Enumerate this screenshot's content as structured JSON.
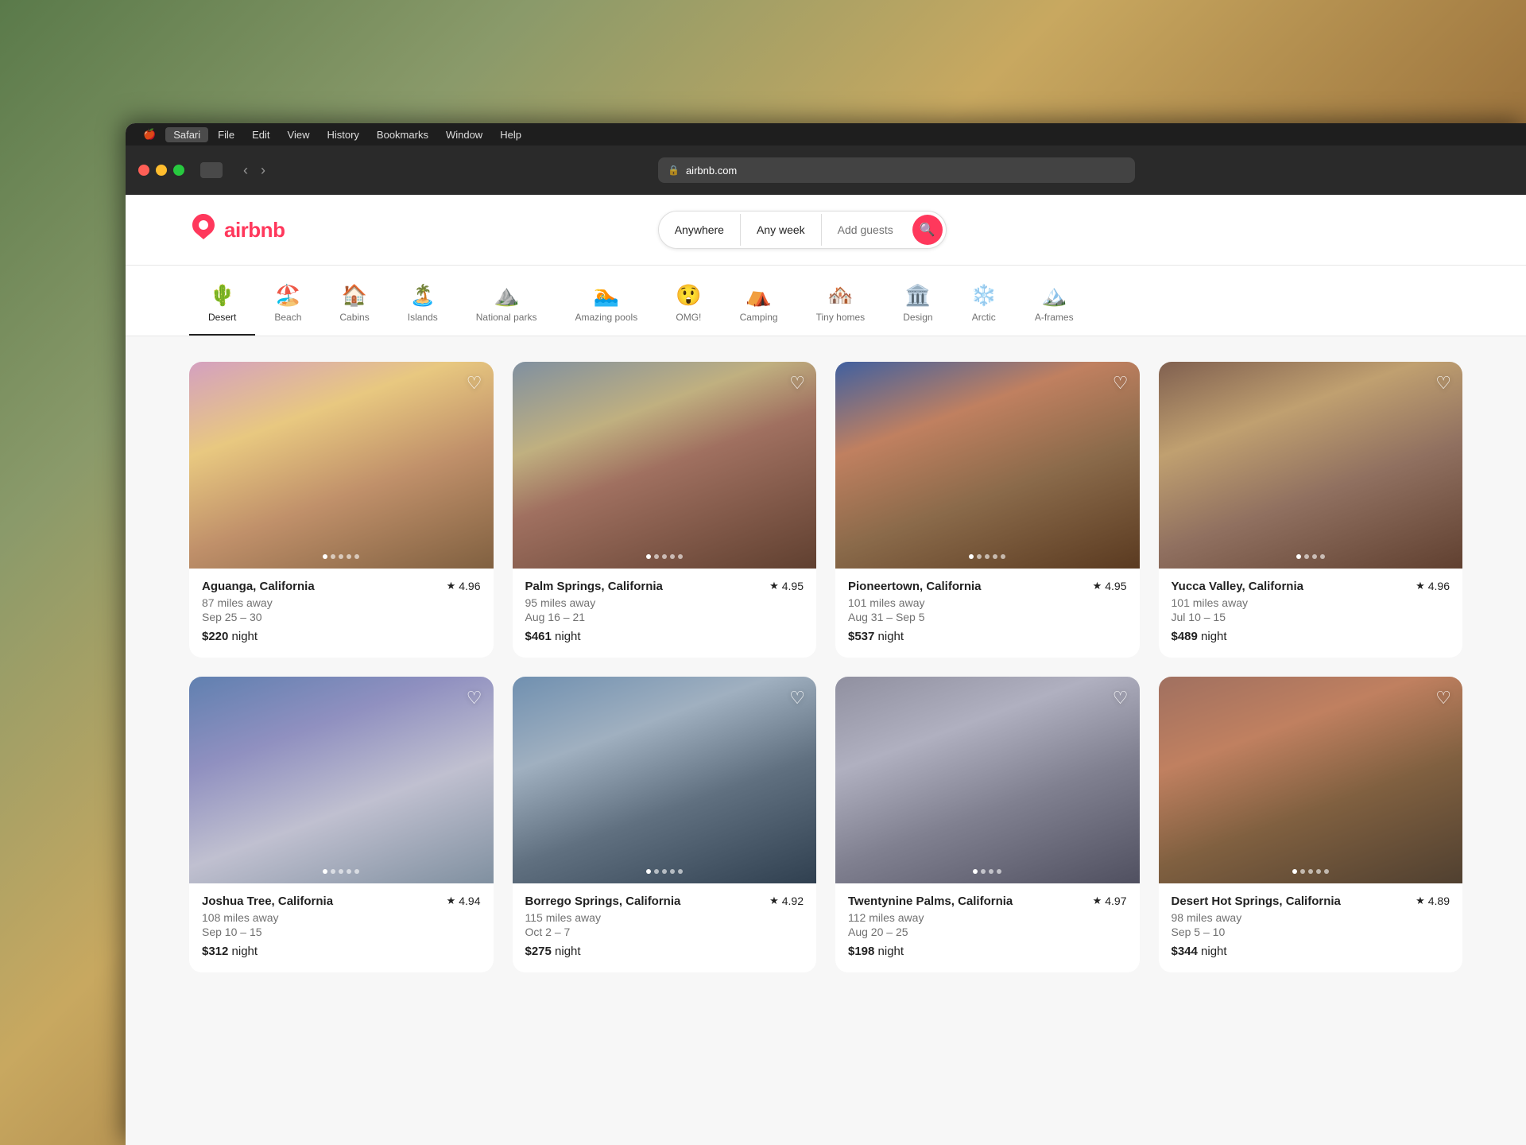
{
  "background": {
    "description": "wooden table background with plants"
  },
  "browser": {
    "menubar": {
      "apple": "🍎",
      "items": [
        "Safari",
        "File",
        "Edit",
        "View",
        "History",
        "Bookmarks",
        "Window",
        "Help"
      ]
    },
    "addressbar": {
      "url": "airbnb.com",
      "lock": "🔒"
    },
    "controls": {
      "back": "‹",
      "forward": "›"
    }
  },
  "header": {
    "logo_text": "airbnb",
    "search": {
      "anywhere": "Anywhere",
      "any_week": "Any week",
      "add_guests": "Add guests",
      "search_icon": "🔍"
    }
  },
  "categories": [
    {
      "id": "desert",
      "label": "Desert",
      "icon": "🌵",
      "active": true
    },
    {
      "id": "beach",
      "label": "Beach",
      "icon": "🏖️",
      "active": false
    },
    {
      "id": "cabins",
      "label": "Cabins",
      "icon": "🏠",
      "active": false
    },
    {
      "id": "islands",
      "label": "Islands",
      "icon": "🏝️",
      "active": false
    },
    {
      "id": "national-parks",
      "label": "National parks",
      "icon": "⛰️",
      "active": false
    },
    {
      "id": "amazing-pools",
      "label": "Amazing pools",
      "icon": "🏊",
      "active": false
    },
    {
      "id": "omg",
      "label": "OMG!",
      "icon": "😲",
      "active": false
    },
    {
      "id": "camping",
      "label": "Camping",
      "icon": "⛺",
      "active": false
    },
    {
      "id": "tiny-homes",
      "label": "Tiny homes",
      "icon": "🏘️",
      "active": false
    },
    {
      "id": "design",
      "label": "Design",
      "icon": "🏛️",
      "active": false
    },
    {
      "id": "arctic",
      "label": "Arctic",
      "icon": "❄️",
      "active": false
    },
    {
      "id": "a-frames",
      "label": "A-frames",
      "icon": "🏔️",
      "active": false
    }
  ],
  "listings": {
    "row1": [
      {
        "id": "aguanga",
        "location": "Aguanga, California",
        "rating": "4.96",
        "distance": "87 miles away",
        "dates": "Sep 25 – 30",
        "price": "$220",
        "price_unit": "night",
        "img_class": "img-aguanga",
        "dots": 5
      },
      {
        "id": "palm-springs",
        "location": "Palm Springs, California",
        "rating": "4.95",
        "distance": "95 miles away",
        "dates": "Aug 16 – 21",
        "price": "$461",
        "price_unit": "night",
        "img_class": "img-palmsprings",
        "dots": 5
      },
      {
        "id": "pioneertown",
        "location": "Pioneertown, California",
        "rating": "4.95",
        "distance": "101 miles away",
        "dates": "Aug 31 – Sep 5",
        "price": "$537",
        "price_unit": "night",
        "img_class": "img-pioneertown",
        "dots": 5
      },
      {
        "id": "yucca-valley",
        "location": "Yucca Valley, California",
        "rating": "4.96",
        "distance": "101 miles away",
        "dates": "Jul 10 – 15",
        "price": "$489",
        "price_unit": "night",
        "img_class": "img-yucca",
        "dots": 4
      }
    ],
    "row2": [
      {
        "id": "b1",
        "location": "Joshua Tree, California",
        "rating": "4.94",
        "distance": "108 miles away",
        "dates": "Sep 10 – 15",
        "price": "$312",
        "price_unit": "night",
        "img_class": "img-b1",
        "dots": 5
      },
      {
        "id": "b2",
        "location": "Borrego Springs, California",
        "rating": "4.92",
        "distance": "115 miles away",
        "dates": "Oct 2 – 7",
        "price": "$275",
        "price_unit": "night",
        "img_class": "img-b2",
        "dots": 5
      },
      {
        "id": "b3",
        "location": "Twentynine Palms, California",
        "rating": "4.97",
        "distance": "112 miles away",
        "dates": "Aug 20 – 25",
        "price": "$198",
        "price_unit": "night",
        "img_class": "img-b3",
        "dots": 4
      },
      {
        "id": "b4",
        "location": "Desert Hot Springs, California",
        "rating": "4.89",
        "distance": "98 miles away",
        "dates": "Sep 5 – 10",
        "price": "$344",
        "price_unit": "night",
        "img_class": "img-b4",
        "dots": 5
      }
    ]
  }
}
